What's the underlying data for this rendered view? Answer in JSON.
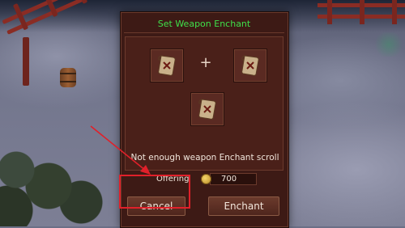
{
  "dialog": {
    "title": "Set Weapon Enchant",
    "slots": [
      {
        "icon": "scroll-icon"
      },
      {
        "icon": "scroll-icon"
      },
      {
        "icon": "scroll-icon"
      }
    ],
    "plus_symbol": "+",
    "message": "Not enough weapon Enchant scroll",
    "offering": {
      "label": "Offering",
      "currency_icon": "gold-coin-icon",
      "value": "700"
    },
    "buttons": {
      "cancel_label": "Cancel",
      "enchant_label": "Enchant"
    }
  },
  "colors": {
    "title_green": "#3fe04a",
    "panel_dark_red": "#3d1a15",
    "annotation_red": "#e0202a"
  }
}
